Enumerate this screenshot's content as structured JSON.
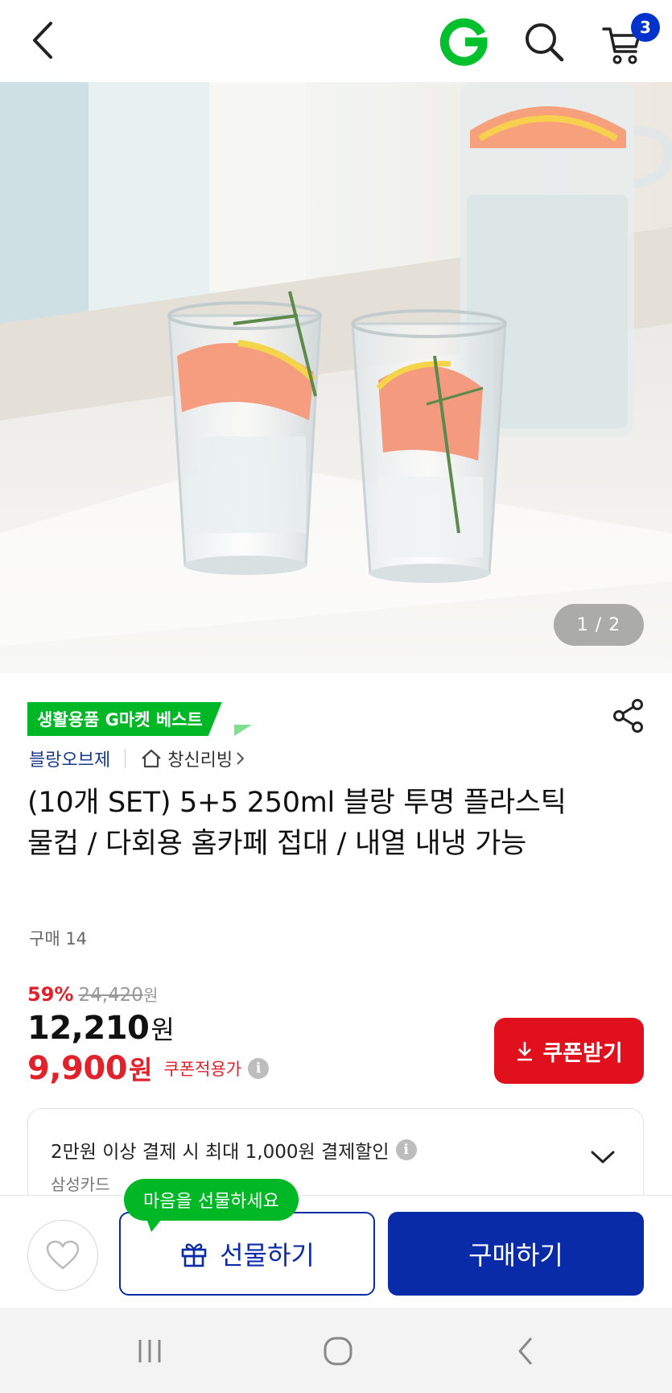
{
  "header": {
    "cart_count": "3"
  },
  "hero": {
    "page_indicator": "1 / 2"
  },
  "product": {
    "best_badge": "생활용품 G마켓 베스트",
    "brand": "블랑오브제",
    "shop_name": "창신리빙",
    "title": "(10개 SET) 5+5 250ml 블랑 투명 플라스틱 물컵 / 다회용 홈카페 접대 / 내열 내냉 가능",
    "purchase_count": "구매 14"
  },
  "price": {
    "discount_rate": "59%",
    "original_price": "24,420",
    "original_unit": "원",
    "sale_price": "12,210",
    "sale_unit": "원",
    "coupon_price": "9,900",
    "coupon_unit": "원",
    "coupon_label": "쿠폰적용가",
    "coupon_button": "쿠폰받기"
  },
  "card_promo": {
    "text": "2만원 이상 결제 시 최대 1,000원 결제할인",
    "card_name": "삼성카드"
  },
  "bottom_bar": {
    "gift_tooltip": "마음을 선물하세요",
    "gift_button": "선물하기",
    "buy_button": "구매하기"
  },
  "colors": {
    "brand_green": "#00b826",
    "accent_red": "#e0222b",
    "primary_blue": "#0a2ba8"
  }
}
